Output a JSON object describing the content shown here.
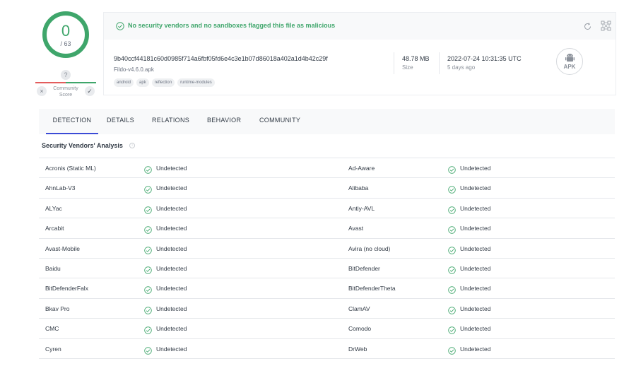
{
  "score": {
    "detected": "0",
    "total": "/ 63"
  },
  "community": {
    "unknown_icon": "?",
    "label": "Community Score",
    "label_line1": "Community",
    "label_line2": "Score",
    "x_icon": "×",
    "check_icon": "✓"
  },
  "banner": {
    "text": "No security vendors and no sandboxes flagged this file as malicious",
    "status_icon": "check-circle-icon",
    "color": "#3fa66b"
  },
  "file": {
    "hash": "9b40ccf44181c60d0985f714a6fbf05fd6e4c3e1b07d86018a402a1d4b42c29f",
    "name": "Fildo-v4.6.0.apk",
    "tags": [
      "android",
      "apk",
      "reflection",
      "runtime-modules"
    ],
    "size_value": "48.78 MB",
    "size_label": "Size",
    "date_value": "2022-07-24 10:31:35 UTC",
    "date_ago": "5 days ago",
    "type_badge": "APK"
  },
  "tabs": [
    "DETECTION",
    "DETAILS",
    "RELATIONS",
    "BEHAVIOR",
    "COMMUNITY"
  ],
  "active_tab": "DETECTION",
  "section": {
    "title": "Security Vendors' Analysis"
  },
  "vendors": [
    [
      "Acronis (Static ML)",
      "Undetected",
      "Ad-Aware",
      "Undetected"
    ],
    [
      "AhnLab-V3",
      "Undetected",
      "Alibaba",
      "Undetected"
    ],
    [
      "ALYac",
      "Undetected",
      "Antiy-AVL",
      "Undetected"
    ],
    [
      "Arcabit",
      "Undetected",
      "Avast",
      "Undetected"
    ],
    [
      "Avast-Mobile",
      "Undetected",
      "Avira (no cloud)",
      "Undetected"
    ],
    [
      "Baidu",
      "Undetected",
      "BitDefender",
      "Undetected"
    ],
    [
      "BitDefenderFalx",
      "Undetected",
      "BitDefenderTheta",
      "Undetected"
    ],
    [
      "Bkav Pro",
      "Undetected",
      "ClamAV",
      "Undetected"
    ],
    [
      "CMC",
      "Undetected",
      "Comodo",
      "Undetected"
    ],
    [
      "Cyren",
      "Undetected",
      "DrWeb",
      "Undetected"
    ]
  ],
  "colors": {
    "accent": "#3b4bd6",
    "clean": "#3fa66b",
    "bad": "#e35d5d",
    "text": "#313a45",
    "muted": "#8a9099"
  }
}
